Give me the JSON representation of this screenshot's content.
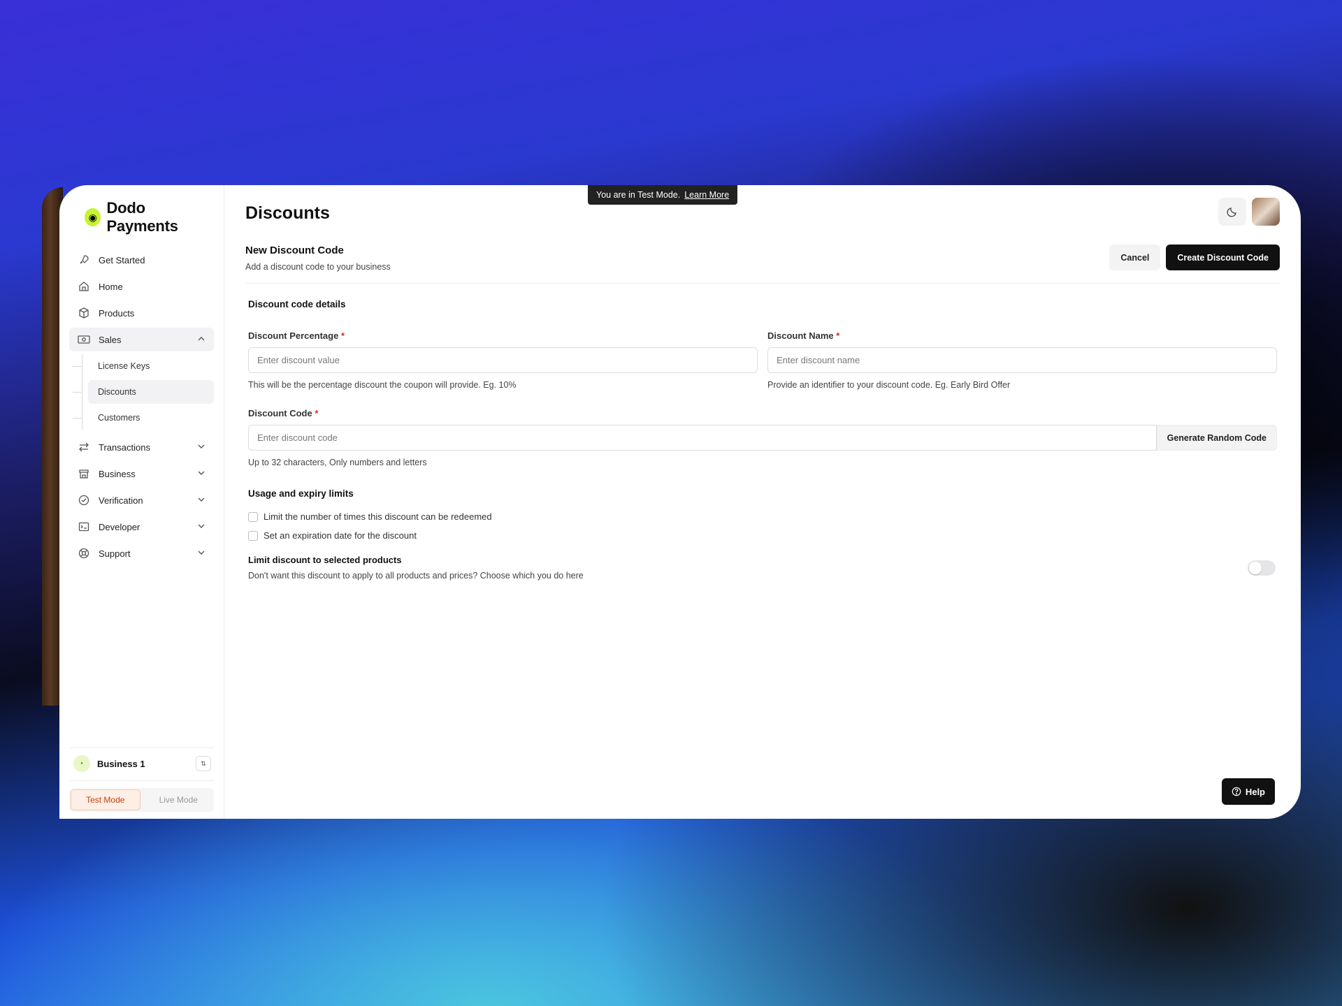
{
  "brand": {
    "name": "Dodo Payments"
  },
  "sidebar": {
    "items": [
      {
        "label": "Get Started",
        "icon": "rocket-icon"
      },
      {
        "label": "Home",
        "icon": "home-icon"
      },
      {
        "label": "Products",
        "icon": "box-icon"
      },
      {
        "label": "Sales",
        "icon": "money-icon"
      },
      {
        "label": "Transactions",
        "icon": "arrows-icon"
      },
      {
        "label": "Business",
        "icon": "store-icon"
      },
      {
        "label": "Verification",
        "icon": "check-circle-icon"
      },
      {
        "label": "Developer",
        "icon": "terminal-icon"
      },
      {
        "label": "Support",
        "icon": "lifebuoy-icon"
      }
    ],
    "sales_sub": [
      "License Keys",
      "Discounts",
      "Customers"
    ],
    "business_name": "Business 1",
    "modes": {
      "test": "Test Mode",
      "live": "Live Mode"
    }
  },
  "banner": {
    "text": "You are in Test Mode.",
    "link": "Learn More"
  },
  "page": {
    "title": "Discounts"
  },
  "section": {
    "title": "New Discount Code",
    "subtitle": "Add a discount code to your business",
    "cancel": "Cancel",
    "create": "Create Discount Code"
  },
  "form": {
    "group_details": "Discount code details",
    "percentage": {
      "label": "Discount Percentage",
      "placeholder": "Enter discount value",
      "hint": "This will be the percentage discount the coupon will provide. Eg. 10%"
    },
    "name": {
      "label": "Discount Name",
      "placeholder": "Enter discount name",
      "hint": "Provide an identifier to your discount code. Eg. Early Bird Offer"
    },
    "code": {
      "label": "Discount Code",
      "placeholder": "Enter discount code",
      "hint": "Up to 32 characters, Only numbers and letters",
      "generate": "Generate Random Code"
    },
    "group_limits": "Usage and expiry limits",
    "limit_redeem": "Limit the number of times this discount can be redeemed",
    "expiry": "Set an expiration date for the discount",
    "products_title": "Limit discount to selected products",
    "products_sub": "Don't want this discount to apply to all products and prices? Choose which you do here"
  },
  "help": "Help"
}
